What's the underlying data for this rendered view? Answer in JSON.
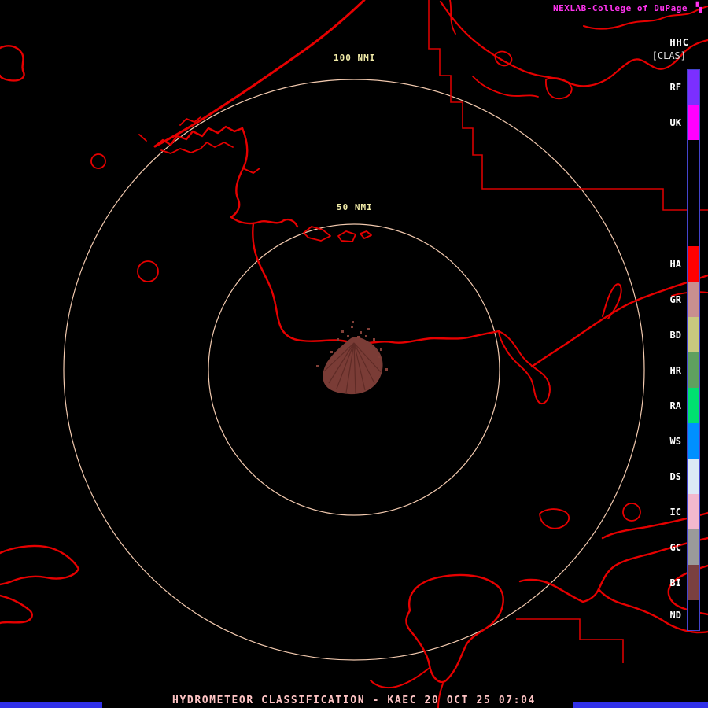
{
  "colors": {
    "background": "#000000",
    "map_outline": "#E60000",
    "range_ring": "#F2C9AE",
    "ring_label": "#F2ECA8",
    "brand_magenta": "#FF33EE",
    "status_text": "#FFC4C4",
    "progress_bar_blue": "#3030E8",
    "echo_biological": "#7A3C36",
    "legend_border": "#4444CC"
  },
  "header": {
    "brand": "NEXLAB-College of DuPage",
    "logo_glyph": "▚",
    "product_code": "HHC",
    "product_tag": "[CLAS]"
  },
  "legend": {
    "items": [
      {
        "label": "RF",
        "color": "#7B2FFF"
      },
      {
        "label": "UK",
        "color": "#FF00FF"
      },
      {
        "label": "HA",
        "color": "#FF0000"
      },
      {
        "label": "GR",
        "color": "#C98F8F"
      },
      {
        "label": "BD",
        "color": "#C9C97F"
      },
      {
        "label": "HR",
        "color": "#5FA05F"
      },
      {
        "label": "RA",
        "color": "#00E070"
      },
      {
        "label": "WS",
        "color": "#0090FF"
      },
      {
        "label": "DS",
        "color": "#DCE9F5"
      },
      {
        "label": "IC",
        "color": "#F2B8CD"
      },
      {
        "label": "GC",
        "color": "#9A9A9A"
      },
      {
        "label": "BI",
        "color": "#7A4040"
      },
      {
        "label": "ND",
        "color": "#000000"
      }
    ]
  },
  "map": {
    "rings": [
      {
        "label": "100 NMI"
      },
      {
        "label": "50 NMI"
      }
    ]
  },
  "footer": {
    "status": "HYDROMETEOR CLASSIFICATION - KAEC 20 OCT 25 07:04",
    "site": "KAEC",
    "date": "20 OCT 25",
    "time": "07:04"
  }
}
